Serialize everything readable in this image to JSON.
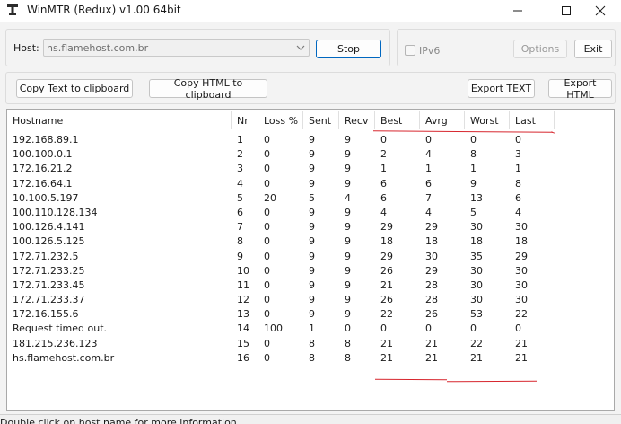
{
  "window": {
    "title": "WinMTR (Redux) v1.00 64bit"
  },
  "host": {
    "label": "Host:",
    "value": "hs.flamehost.com.br",
    "stop_label": "Stop"
  },
  "options": {
    "ipv6_label": "IPv6",
    "ipv6_checked": false,
    "options_label": "Options",
    "exit_label": "Exit"
  },
  "toolbar": {
    "copy_text_label": "Copy Text to clipboard",
    "copy_html_label": "Copy HTML to clipboard",
    "export_text_label": "Export TEXT",
    "export_html_label": "Export HTML"
  },
  "table": {
    "columns": [
      "Hostname",
      "Nr",
      "Loss %",
      "Sent",
      "Recv",
      "Best",
      "Avrg",
      "Worst",
      "Last"
    ],
    "rows": [
      [
        "192.168.89.1",
        "1",
        "0",
        "9",
        "9",
        "0",
        "0",
        "0",
        "0"
      ],
      [
        "100.100.0.1",
        "2",
        "0",
        "9",
        "9",
        "2",
        "4",
        "8",
        "3"
      ],
      [
        "172.16.21.2",
        "3",
        "0",
        "9",
        "9",
        "1",
        "1",
        "1",
        "1"
      ],
      [
        "172.16.64.1",
        "4",
        "0",
        "9",
        "9",
        "6",
        "6",
        "9",
        "8"
      ],
      [
        "10.100.5.197",
        "5",
        "20",
        "5",
        "4",
        "6",
        "7",
        "13",
        "6"
      ],
      [
        "100.110.128.134",
        "6",
        "0",
        "9",
        "9",
        "4",
        "4",
        "5",
        "4"
      ],
      [
        "100.126.4.141",
        "7",
        "0",
        "9",
        "9",
        "29",
        "29",
        "30",
        "30"
      ],
      [
        "100.126.5.125",
        "8",
        "0",
        "9",
        "9",
        "18",
        "18",
        "18",
        "18"
      ],
      [
        "172.71.232.5",
        "9",
        "0",
        "9",
        "9",
        "29",
        "30",
        "35",
        "29"
      ],
      [
        "172.71.233.25",
        "10",
        "0",
        "9",
        "9",
        "26",
        "29",
        "30",
        "30"
      ],
      [
        "172.71.233.45",
        "11",
        "0",
        "9",
        "9",
        "21",
        "28",
        "30",
        "30"
      ],
      [
        "172.71.233.37",
        "12",
        "0",
        "9",
        "9",
        "26",
        "28",
        "30",
        "30"
      ],
      [
        "172.16.155.6",
        "13",
        "0",
        "9",
        "9",
        "22",
        "26",
        "53",
        "22"
      ],
      [
        "Request timed out.",
        "14",
        "100",
        "1",
        "0",
        "0",
        "0",
        "0",
        "0"
      ],
      [
        "181.215.236.123",
        "15",
        "0",
        "8",
        "8",
        "21",
        "21",
        "22",
        "21"
      ],
      [
        "hs.flamehost.com.br",
        "16",
        "0",
        "8",
        "8",
        "21",
        "21",
        "21",
        "21"
      ]
    ]
  },
  "status": {
    "text": "Double click on host name for more information."
  },
  "colors": {
    "annotation": "#d7262e",
    "accent": "#0067c0"
  }
}
